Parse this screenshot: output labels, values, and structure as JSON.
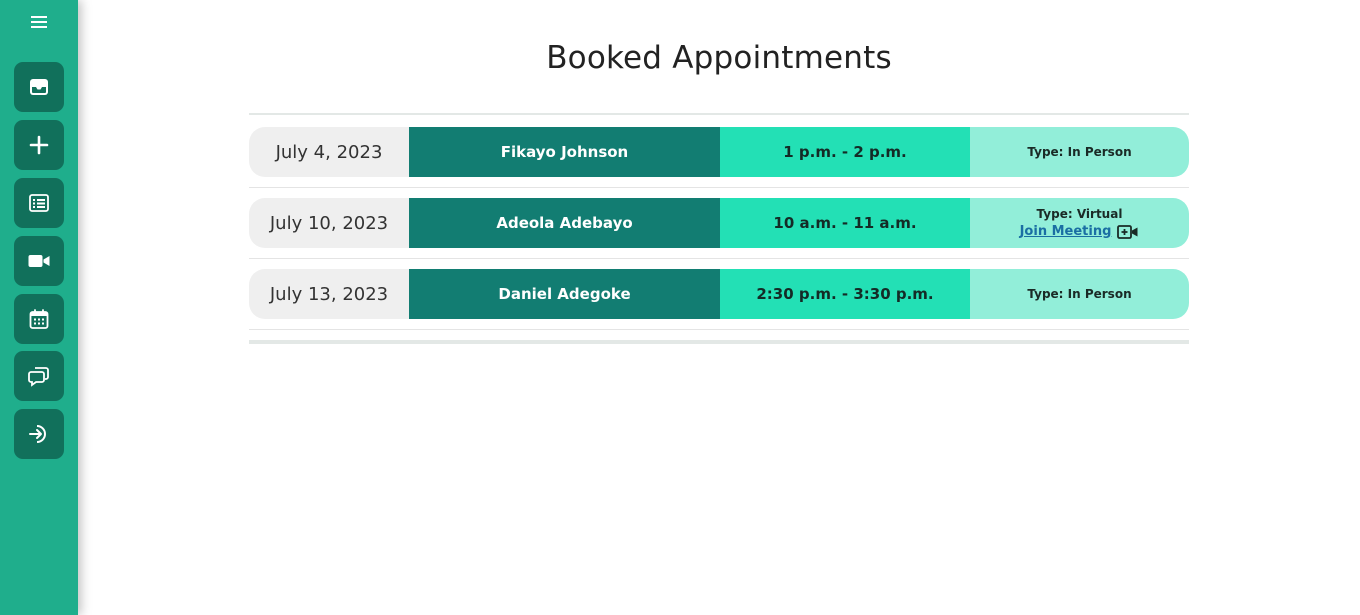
{
  "sidebar": {
    "menu_icon": "hamburger-icon",
    "items": [
      {
        "name": "inbox",
        "icon": "inbox-icon"
      },
      {
        "name": "add",
        "icon": "plus-icon"
      },
      {
        "name": "list",
        "icon": "list-icon"
      },
      {
        "name": "video",
        "icon": "video-camera-icon"
      },
      {
        "name": "calendar",
        "icon": "calendar-icon"
      },
      {
        "name": "chat",
        "icon": "chat-icon"
      },
      {
        "name": "logout",
        "icon": "sign-in-icon"
      }
    ],
    "colors": {
      "background": "#1fae8c",
      "button": "#11705b"
    }
  },
  "main": {
    "title": "Booked Appointments",
    "appointments": [
      {
        "date": "July 4, 2023",
        "name": "Fikayo Johnson",
        "time": "1 p.m. - 2 p.m.",
        "type": "Type: In Person"
      },
      {
        "date": "July 10, 2023",
        "name": "Adeola Adebayo",
        "time": "10 a.m. - 11 a.m.",
        "type": "Type: Virtual",
        "join_label": "Join Meeting"
      },
      {
        "date": "July 13, 2023",
        "name": "Daniel Adegoke",
        "time": "2:30 p.m. - 3:30 p.m.",
        "type": "Type: In Person"
      }
    ],
    "colors": {
      "name_bg": "#127d72",
      "time_bg": "#23e0b5",
      "type_bg": "#92eed9",
      "date_bg": "#efefef"
    }
  }
}
